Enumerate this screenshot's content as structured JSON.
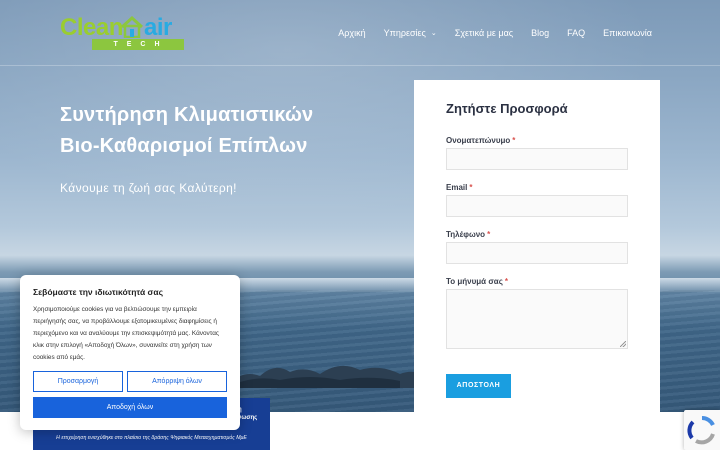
{
  "header": {
    "logo": {
      "word1": "Clean",
      "word2": "air",
      "tagline": "TECH"
    },
    "nav": [
      {
        "label": "Αρχική"
      },
      {
        "label": "Υπηρεσίες",
        "has_dropdown": true
      },
      {
        "label": "Σχετικά με μας"
      },
      {
        "label": "Blog"
      },
      {
        "label": "FAQ"
      },
      {
        "label": "Επικοινωνία"
      }
    ]
  },
  "hero": {
    "title_line1": "Συντήρηση Κλιματιστικών",
    "title_line2": "Βιο-Καθαρισμοί Επίπλων",
    "subtitle": "Κάνουμε τη ζωή σας Καλύτερη!"
  },
  "form": {
    "title": "Ζητήστε Προσφορά",
    "required_mark": "*",
    "fields": [
      {
        "label": "Ονοματεπώνυμο",
        "value": ""
      },
      {
        "label": "Email",
        "value": ""
      },
      {
        "label": "Τηλέφωνο",
        "value": ""
      },
      {
        "label": "Το μήνυμά σας",
        "value": ""
      }
    ],
    "submit_label": "ΑΠΟΣΤΟΛΗ"
  },
  "cookie": {
    "title": "Σεβόμαστε την ιδιωτικότητά σας",
    "text": "Χρησιμοποιούμε cookies για να βελτιώσουμε την εμπειρία περιήγησής σας, να προβάλλουμε εξατομικευμένες διαφημίσεις ή περιεχόμενο και να αναλύουμε την επισκεψιμότητά μας. Κάνοντας κλικ στην επιλογή «Αποδοχή Όλων», συναινείτε στη χρήση των cookies από εμάς.",
    "prefs_label": "Προσαρμογή",
    "reject_label": "Απόρριψη όλων",
    "accept_label": "Αποδοχή όλων"
  },
  "banner": {
    "text_line1": "η",
    "text_line2": "νωσης",
    "footer": "Η επιχείρηση ενισχύθηκε στο πλαίσιο της δράσης Ψηφιακός Μετασχηματισμός ΜμΕ"
  },
  "colors": {
    "accent": "#1a9ee0",
    "cookie_blue": "#1863dc",
    "logo_green": "#8cc63f",
    "logo_blue": "#29abe2",
    "banner_blue": "#173e94"
  }
}
